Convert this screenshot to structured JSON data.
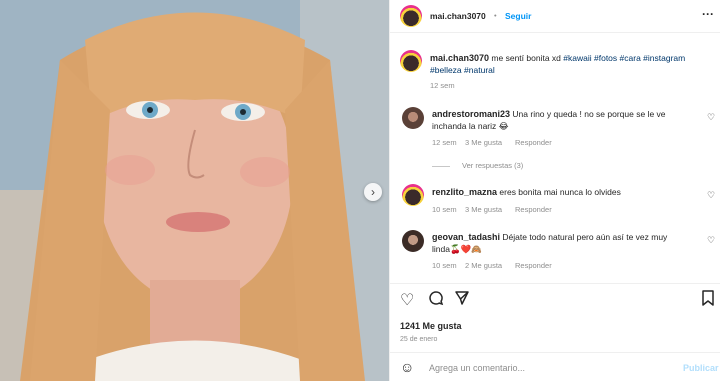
{
  "post": {
    "username": "mai.chan3070",
    "follow_label": "Seguir",
    "caption_text": "me sentí bonita xd",
    "hashtags": [
      "#kawaii",
      "#fotos",
      "#cara",
      "#instagram",
      "#belleza",
      "#natural"
    ],
    "caption_time": "12 sem",
    "likes": "1241 Me gusta",
    "date": "25 de enero"
  },
  "comments": [
    {
      "user": "andrestoromani23",
      "text_line1": "Una rino y queda ! no se porque se le ve",
      "text_line2": "inchanda la nariz 😂",
      "time": "12 sem",
      "likes": "3 Me gusta",
      "reply": "Responder",
      "view_replies": "Ver respuestas (3)"
    },
    {
      "user": "renzlito_mazna",
      "text_line1": "eres bonita mai nunca lo olvides",
      "text_line2": "",
      "time": "10 sem",
      "likes": "3 Me gusta",
      "reply": "Responder"
    },
    {
      "user": "geovan_tadashi",
      "text_line1": "Déjate todo natural pero aún así te vez muy",
      "text_line2": "linda🍒❤️🙈",
      "time": "10 sem",
      "likes": "2 Me gusta",
      "reply": "Responder"
    }
  ],
  "composer": {
    "placeholder": "Agrega un comentario...",
    "publish_label": "Publicar"
  },
  "icons": {
    "more": "more-icon",
    "like": "heart-icon",
    "comment": "comment-icon",
    "share": "share-icon",
    "save": "bookmark-icon",
    "emoji": "emoji-icon",
    "next": "chevron-right-icon"
  },
  "colors": {
    "accent": "#0095f6",
    "link": "#00376b",
    "muted": "#8e8e8e"
  }
}
